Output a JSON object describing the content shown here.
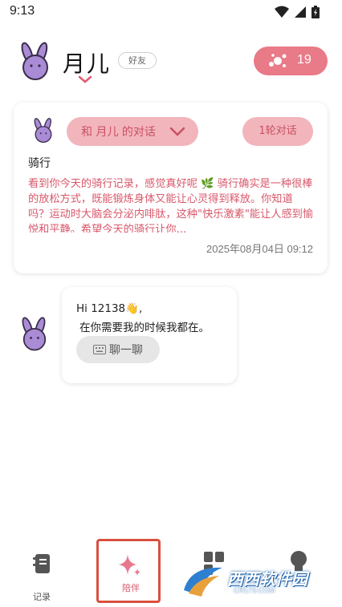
{
  "status_bar": {
    "time": "9:13"
  },
  "header": {
    "name": "月儿",
    "relation_badge": "好友",
    "sparkle_count": "19"
  },
  "card": {
    "conversation_label": "和 月儿 的对话",
    "rounds_label": "1轮对话",
    "title": "骑行",
    "body": "看到你今天的骑行记录，感觉真好呢 🌿 骑行确实是一种很棒的放松方式，既能锻炼身体又能让心灵得到释放。你知道吗？运动时大脑会分泌内啡肽，这种\"快乐激素\"能让人感到愉悦和平静。希望今天的骑行让你...",
    "timestamp": "2025年08月04日 09:12"
  },
  "chat": {
    "greeting": "Hi 12138👋,",
    "message": "在你需要我的时候我都在。",
    "chat_button": "聊一聊"
  },
  "nav": {
    "items": [
      {
        "label": "记录"
      },
      {
        "label": "陪伴"
      },
      {
        "label": ""
      },
      {
        "label": ""
      }
    ]
  },
  "watermark": {
    "text": "西西软件园",
    "sub": "CR173.COM"
  },
  "colors": {
    "accent": "#e97a88",
    "pill_bg": "#f2b5bc",
    "body_text": "#d9586b",
    "active_border": "#d9503f",
    "bunny": "#a98bd6"
  }
}
